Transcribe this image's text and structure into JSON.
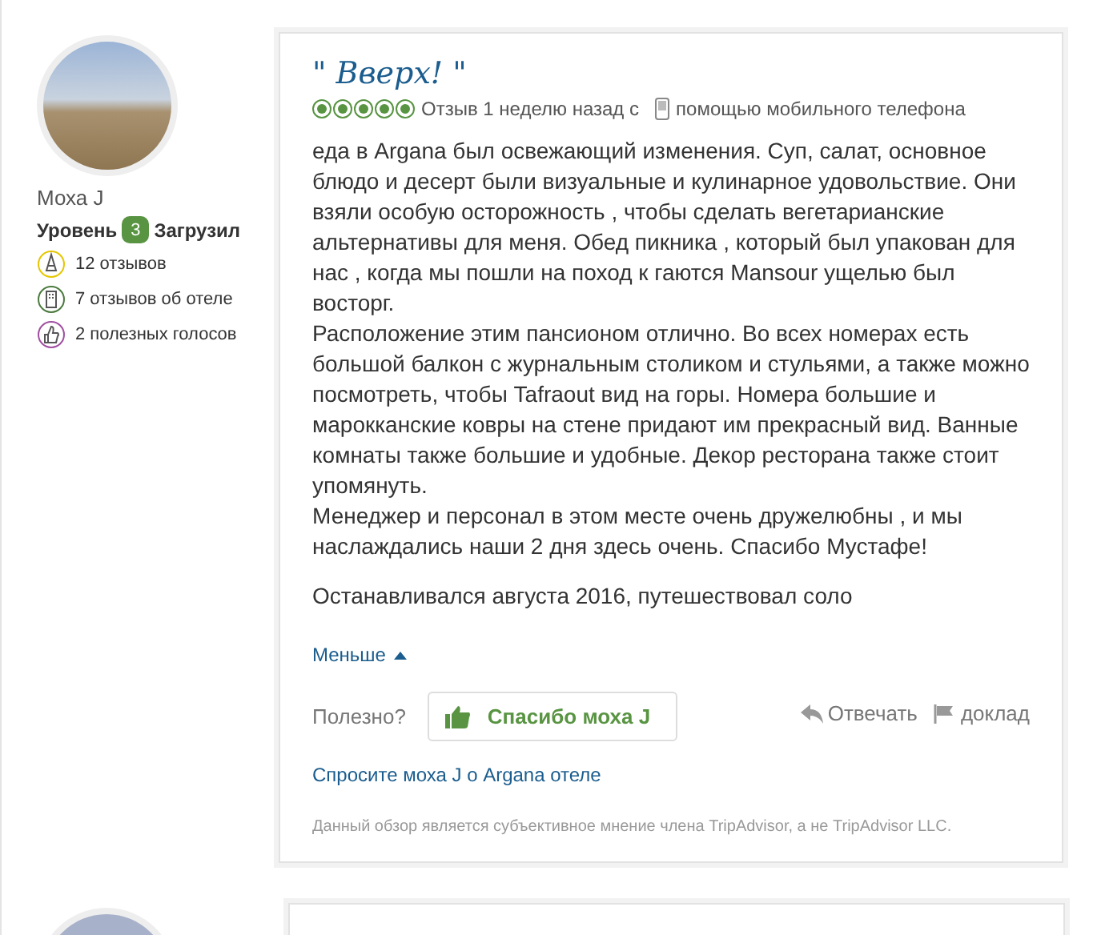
{
  "reviewer": {
    "name": "Моха J",
    "level_label": "Уровень",
    "level": "3",
    "badge": "Загрузил",
    "stats": [
      {
        "kind": "reviews",
        "text": "12 отзывов"
      },
      {
        "kind": "hotel",
        "text": "7 отзывов об отеле"
      },
      {
        "kind": "helpful",
        "text": "2 полезных голосов"
      }
    ]
  },
  "review": {
    "title": "\" Вверх! \"",
    "stars": 5,
    "date": "Отзыв 1 неделю назад с",
    "via": "помощью мобильного телефона",
    "paragraphs": [
      "еда в Argana был освежающий изменения. Суп, салат, основное блюдо и десерт были визуальные и кулинарное удовольствие. Они взяли особую осторожность , чтобы сделать вегетарианские альтернативы для меня. Обед пикника , который был упакован для нас , когда мы пошли на поход к гаются Mansour ущелью был восторг.",
      "Расположение этим пансионом отлично. Во всех номерах есть большой балкон с журнальным столиком и стульями, а также можно посмотреть, чтобы Tafraout вид на горы. Номера большие и марокканские ковры на стене придают им прекрасный вид. Ванные комнаты также большие и удобные. Декор ресторана также стоит упомянуть.",
      "Менеджер и персонал в этом месте очень дружелюбны , и мы наслаждались наши 2 дня здесь очень. Спасибо Мустафе!"
    ],
    "stayed": "Останавливался августа 2016, путешествовал соло",
    "less": "Меньше",
    "helpful": "Полезно?",
    "thanks": "Спасибо моха J",
    "reply": "Отвечать",
    "report": "доклад",
    "ask": "Спросите моха J о Argana отеле",
    "disclaimer": "Данный обзор является субъективное мнение члена TripAdvisor, а не TripAdvisor LLC."
  }
}
